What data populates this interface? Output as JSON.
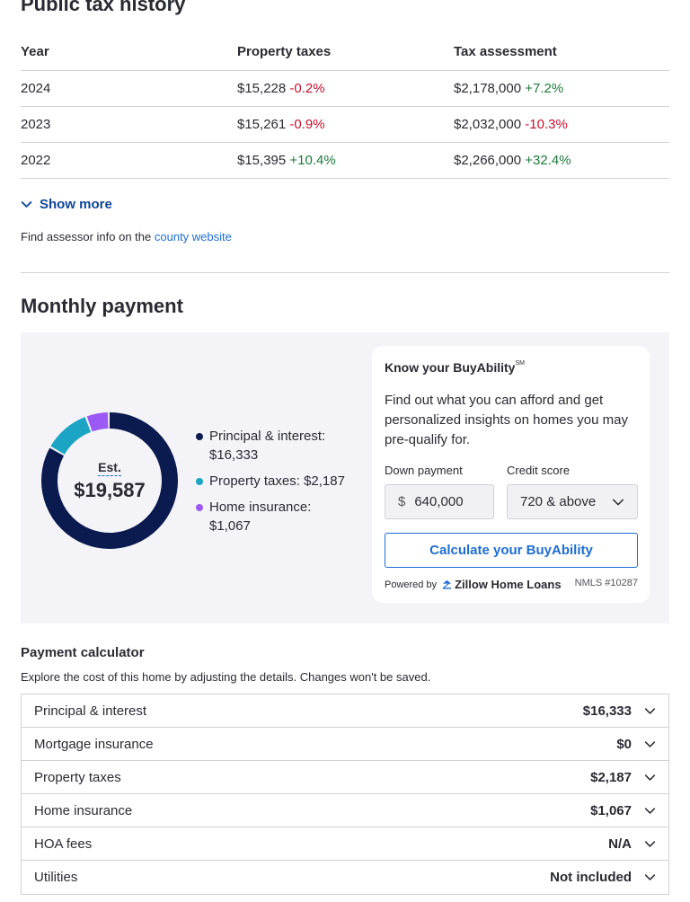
{
  "tax_history": {
    "title": "Public tax history",
    "headers": [
      "Year",
      "Property taxes",
      "Tax assessment"
    ],
    "rows": [
      {
        "year": "2024",
        "tax": "$15,228",
        "tax_change": "-0.2%",
        "assessment": "$2,178,000",
        "assessment_change": "+7.2%"
      },
      {
        "year": "2023",
        "tax": "$15,261",
        "tax_change": "-0.9%",
        "assessment": "$2,032,000",
        "assessment_change": "-10.3%"
      },
      {
        "year": "2022",
        "tax": "$15,395",
        "tax_change": "+10.4%",
        "assessment": "$2,266,000",
        "assessment_change": "+32.4%"
      }
    ],
    "show_more": "Show more",
    "assessor_text": "Find assessor info on the",
    "assessor_link": "county website"
  },
  "monthly_payment": {
    "title": "Monthly payment",
    "donut": {
      "est_label": "Est.",
      "total": "$19,587",
      "segments": [
        {
          "label": "Principal & interest:",
          "value": "$16,333",
          "amount": 16333,
          "color": "#0b1a4f"
        },
        {
          "label": "Property taxes:",
          "value": "$2,187",
          "amount": 2187,
          "color": "#1ca4c4"
        },
        {
          "label": "Home insurance:",
          "value": "$1,067",
          "amount": 1067,
          "color": "#9b59f5"
        }
      ]
    },
    "buyability": {
      "title": "Know your BuyAbility",
      "title_mark": "SM",
      "description": "Find out what you can afford and get personalized insights on homes you may pre-qualify for.",
      "down_payment_label": "Down payment",
      "down_payment_value": "640,000",
      "currency_symbol": "$",
      "credit_score_label": "Credit score",
      "credit_score_value": "720 & above",
      "button_label": "Calculate your BuyAbility",
      "powered_by": "Powered by",
      "logo_text": "Zillow Home Loans",
      "nmls": "NMLS #10287"
    }
  },
  "payment_calculator": {
    "title": "Payment calculator",
    "description": "Explore the cost of this home by adjusting the details. Changes won't be saved.",
    "rows": [
      {
        "label": "Principal & interest",
        "value": "$16,333"
      },
      {
        "label": "Mortgage insurance",
        "value": "$0"
      },
      {
        "label": "Property taxes",
        "value": "$2,187"
      },
      {
        "label": "Home insurance",
        "value": "$1,067"
      },
      {
        "label": "HOA fees",
        "value": "N/A"
      },
      {
        "label": "Utilities",
        "value": "Not included"
      }
    ]
  }
}
